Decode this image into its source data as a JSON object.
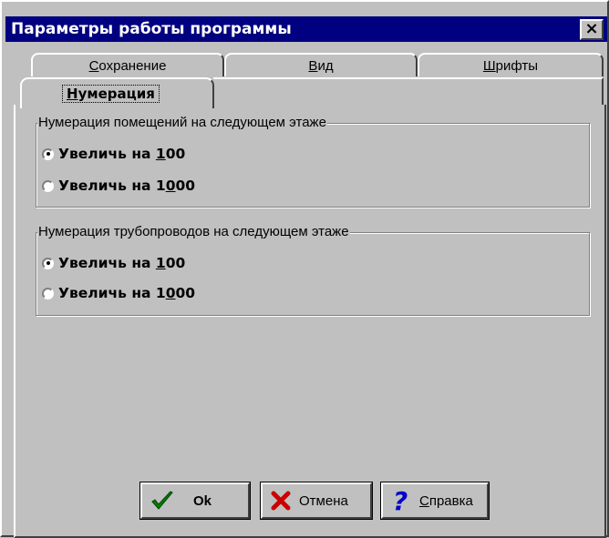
{
  "window": {
    "title": "Параметры работы программы",
    "close_label": "×"
  },
  "tabs": {
    "back_row": [
      {
        "label_underline": "С",
        "label_rest": "охранение"
      },
      {
        "label_underline": "В",
        "label_rest": "ид"
      },
      {
        "label_underline": "Ш",
        "label_rest": "рифты"
      }
    ],
    "active": {
      "label_underline": "Н",
      "label_rest": "умерация"
    }
  },
  "groups": [
    {
      "title": "Нумерация помещений на следующем этаже",
      "options": [
        {
          "label_pre": "Увеличь на ",
          "label_u": "1",
          "label_post": "00",
          "checked": true
        },
        {
          "label_pre": "Увеличь на 1",
          "label_u": "0",
          "label_post": "00",
          "checked": false
        }
      ]
    },
    {
      "title": "Нумерация трубопроводов на следующем этаже",
      "options": [
        {
          "label_pre": "Увеличь на ",
          "label_u": "1",
          "label_post": "00",
          "checked": true
        },
        {
          "label_pre": "Увеличь на 1",
          "label_u": "0",
          "label_post": "00",
          "checked": false
        }
      ]
    }
  ],
  "buttons": {
    "ok": {
      "label": "Ok",
      "icon": "checkmark-icon",
      "color": "#008000"
    },
    "cancel": {
      "label": "Отмена",
      "icon": "x-icon",
      "color": "#cc0000"
    },
    "help": {
      "label_underline": "С",
      "label_rest": "правка",
      "icon": "question-icon",
      "color": "#0000cc"
    }
  }
}
